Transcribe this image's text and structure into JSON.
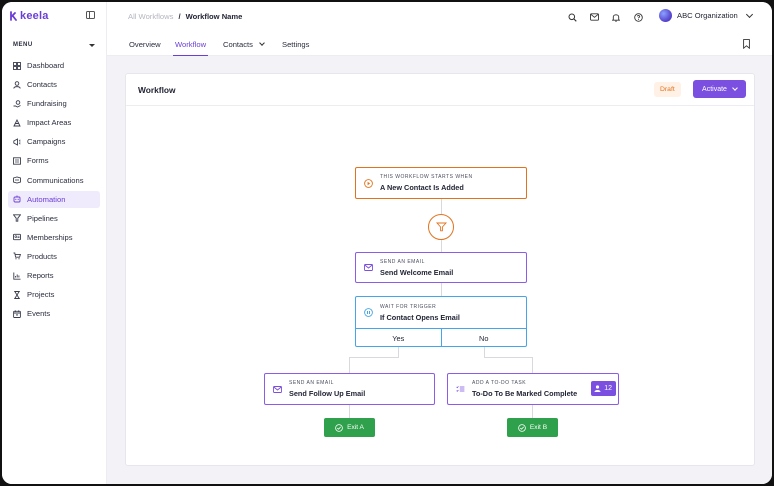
{
  "app": {
    "brand": "keela"
  },
  "sidebar": {
    "menu_label": "MENU",
    "items": [
      {
        "label": "Dashboard",
        "icon": "dashboard-icon"
      },
      {
        "label": "Contacts",
        "icon": "contacts-icon"
      },
      {
        "label": "Fundraising",
        "icon": "fundraising-icon"
      },
      {
        "label": "Impact Areas",
        "icon": "impact-areas-icon"
      },
      {
        "label": "Campaigns",
        "icon": "campaigns-icon"
      },
      {
        "label": "Forms",
        "icon": "forms-icon"
      },
      {
        "label": "Communications",
        "icon": "communications-icon"
      },
      {
        "label": "Automation",
        "icon": "automation-icon",
        "active": true
      },
      {
        "label": "Pipelines",
        "icon": "pipelines-icon"
      },
      {
        "label": "Memberships",
        "icon": "memberships-icon"
      },
      {
        "label": "Products",
        "icon": "products-icon"
      },
      {
        "label": "Reports",
        "icon": "reports-icon"
      },
      {
        "label": "Projects",
        "icon": "projects-icon"
      },
      {
        "label": "Events",
        "icon": "events-icon"
      }
    ]
  },
  "header": {
    "breadcrumb_parent": "All Workflows",
    "breadcrumb_sep": "/",
    "breadcrumb_current": "Workflow Name",
    "org_name": "ABC Organization"
  },
  "tabs": [
    {
      "label": "Overview"
    },
    {
      "label": "Workflow",
      "active": true
    },
    {
      "label": "Contacts"
    },
    {
      "label": "Settings"
    }
  ],
  "card": {
    "title": "Workflow",
    "status": "Draft",
    "activate_label": "Activate"
  },
  "flow": {
    "trigger": {
      "kicker": "THIS WORKFLOW STARTS WHEN",
      "title": "A New Contact Is Added"
    },
    "email1": {
      "kicker": "SEND AN EMAIL",
      "title": "Send Welcome Email"
    },
    "wait": {
      "kicker": "WAIT FOR TRIGGER",
      "title": "If Contact Opens Email",
      "yes": "Yes",
      "no": "No"
    },
    "email2": {
      "kicker": "SEND AN EMAIL",
      "title": "Send Follow Up Email"
    },
    "task": {
      "kicker": "ADD A TO-DO TASK",
      "title": "To-Do To Be Marked Complete",
      "count": "12"
    },
    "exit_a": "Exit A",
    "exit_b": "Exit B"
  },
  "colors": {
    "accent": "#7b4fe0",
    "trigger": "#e2731e",
    "wait": "#46a5e6",
    "exit": "#2fa04b",
    "draft_bg": "#fff1e6"
  }
}
